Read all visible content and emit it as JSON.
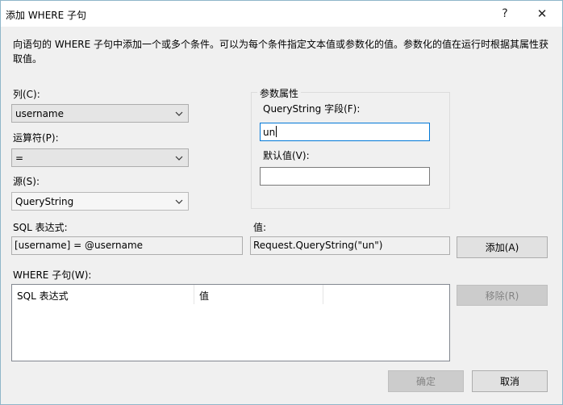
{
  "window": {
    "title": "添加 WHERE 子句",
    "help_symbol": "?",
    "close_symbol": "✕"
  },
  "description": "向语句的 WHERE 子句中添加一个或多个条件。可以为每个条件指定文本值或参数化的值。参数化的值在运行时根据其属性获取值。",
  "column": {
    "label": "列(C):",
    "value": "username"
  },
  "operator": {
    "label": "运算符(P):",
    "value": "="
  },
  "source": {
    "label": "源(S):",
    "value": "QueryString"
  },
  "params": {
    "group_title": "参数属性",
    "field_label": "QueryString 字段(F):",
    "field_value": "un",
    "default_label": "默认值(V):",
    "default_value": ""
  },
  "sql_expression": {
    "label": "SQL 表达式:",
    "value": "[username] = @username"
  },
  "value_field": {
    "label": "值:",
    "value": "Request.QueryString(\"un\")"
  },
  "buttons": {
    "add": "添加(A)",
    "remove": "移除(R)",
    "ok": "确定",
    "cancel": "取消"
  },
  "where_clause": {
    "label": "WHERE 子句(W):",
    "columns": [
      "SQL 表达式",
      "值",
      ""
    ]
  },
  "icons": {
    "dropdown": "chevron-down-icon"
  }
}
